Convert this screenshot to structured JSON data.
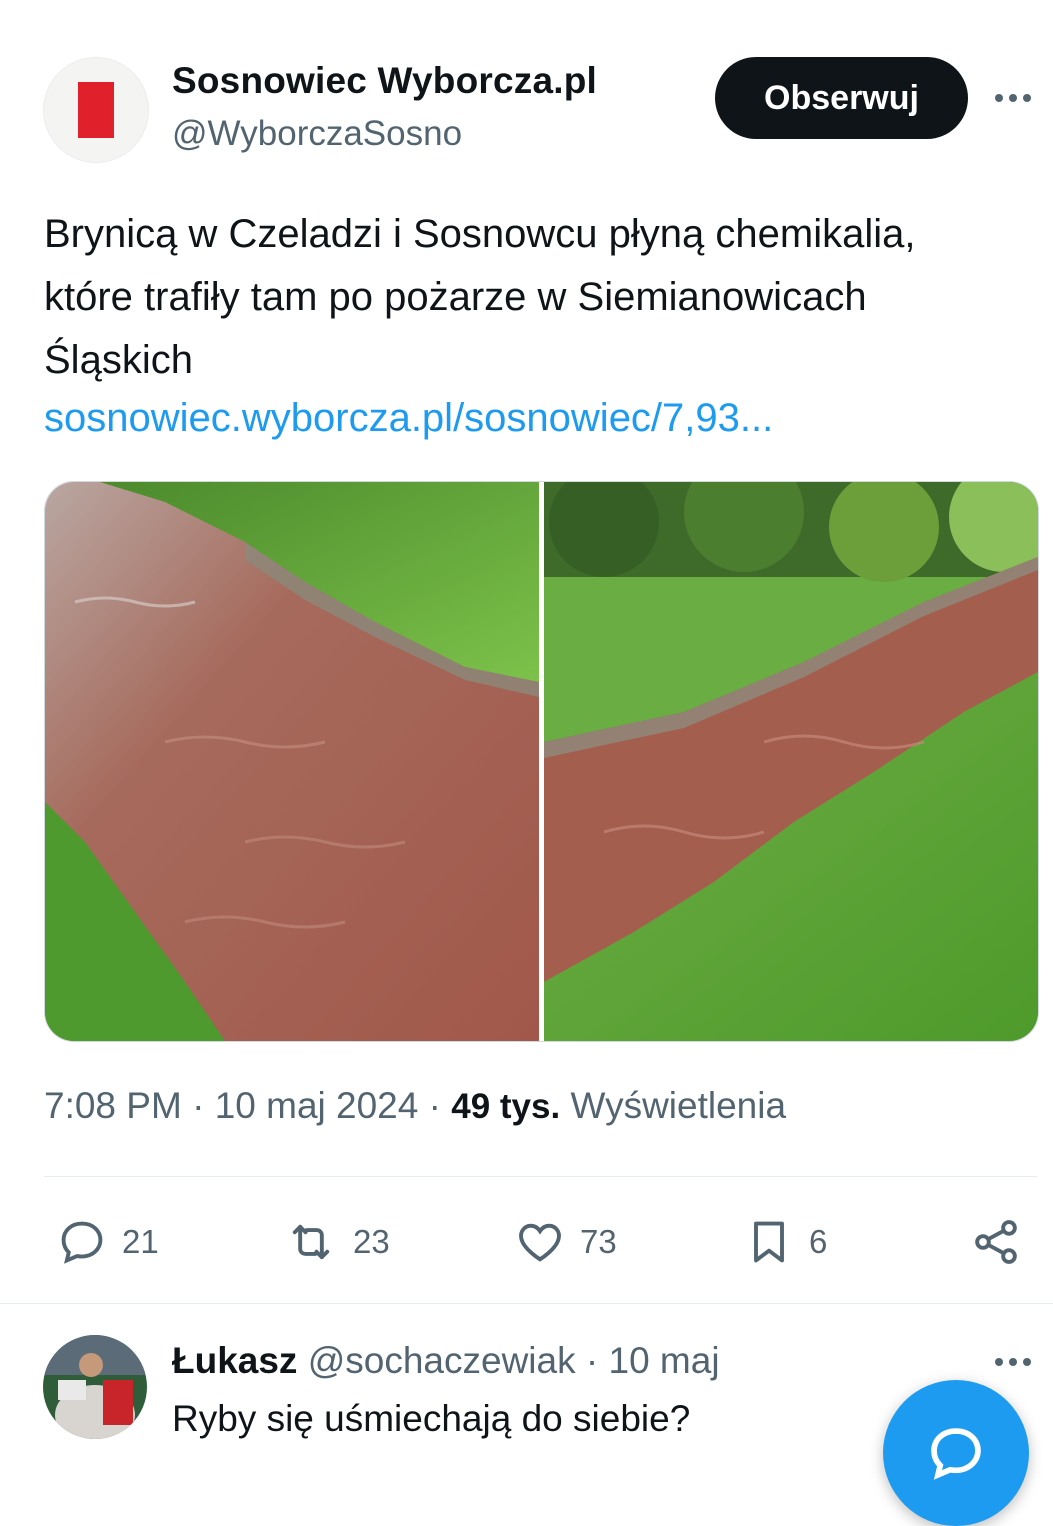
{
  "post": {
    "author": {
      "display_name": "Sosnowiec Wyborcza.pl",
      "handle": "@WyborczaSosno",
      "avatar_color": "#e0202a"
    },
    "follow_label": "Obserwuj",
    "text_lines": [
      "Brynicą w Czeladzi i Sosnowcu płyną chemikalia,",
      "które trafiły tam po pożarze w Siemianowicach",
      "Śląskich"
    ],
    "link": "sosnowiec.wyborcza.pl/sosnowiec/7,93...",
    "media_count": 2,
    "time": "7:08 PM",
    "separator": "·",
    "date": "10 maj 2024",
    "views_count": "49 tys.",
    "views_label": "Wyświetlenia"
  },
  "actions": {
    "replies": "21",
    "reposts": "23",
    "likes": "73",
    "bookmarks": "6"
  },
  "reply": {
    "display_name": "Łukasz",
    "handle": "@sochaczewiak",
    "separator": "·",
    "date": "10 maj",
    "text": "Ryby się uśmiechają do siebie?"
  },
  "colors": {
    "accent": "#1d9bf0",
    "link": "#1d9bf0",
    "water": "#a85a4a",
    "grass": "#5fa33a"
  }
}
